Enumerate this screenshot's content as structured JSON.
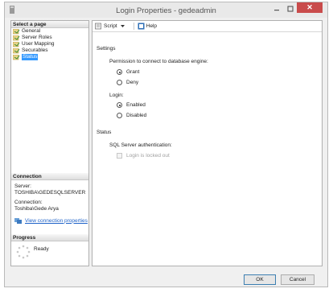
{
  "window": {
    "title": "Login Properties - gedeadmin",
    "close_glyph": "✕"
  },
  "left_panel": {
    "select_page_header": "Select a page",
    "pages": [
      {
        "label": "General"
      },
      {
        "label": "Server Roles"
      },
      {
        "label": "User Mapping"
      },
      {
        "label": "Securables"
      },
      {
        "label": "Status"
      }
    ],
    "connection": {
      "header": "Connection",
      "server_label": "Server:",
      "server_value": "TOSHIBA\\GEDESQLSERVER",
      "connection_label": "Connection:",
      "connection_value": "Toshiba\\Gede Arya",
      "view_link": "View connection properties"
    },
    "progress": {
      "header": "Progress",
      "status": "Ready"
    }
  },
  "toolbar": {
    "script_label": "Script",
    "help_label": "Help"
  },
  "settings": {
    "heading": "Settings",
    "permission_label": "Permission to connect to database engine:",
    "permission_options": [
      {
        "label": "Grant",
        "selected": true
      },
      {
        "label": "Deny",
        "selected": false
      }
    ],
    "login_label": "Login:",
    "login_options": [
      {
        "label": "Enabled",
        "selected": true
      },
      {
        "label": "Disabled",
        "selected": false
      }
    ]
  },
  "status": {
    "heading": "Status",
    "auth_label": "SQL Server authentication:",
    "locked_out_label": "Login is locked out",
    "locked_out_checked": false
  },
  "buttons": {
    "ok": "OK",
    "cancel": "Cancel"
  }
}
